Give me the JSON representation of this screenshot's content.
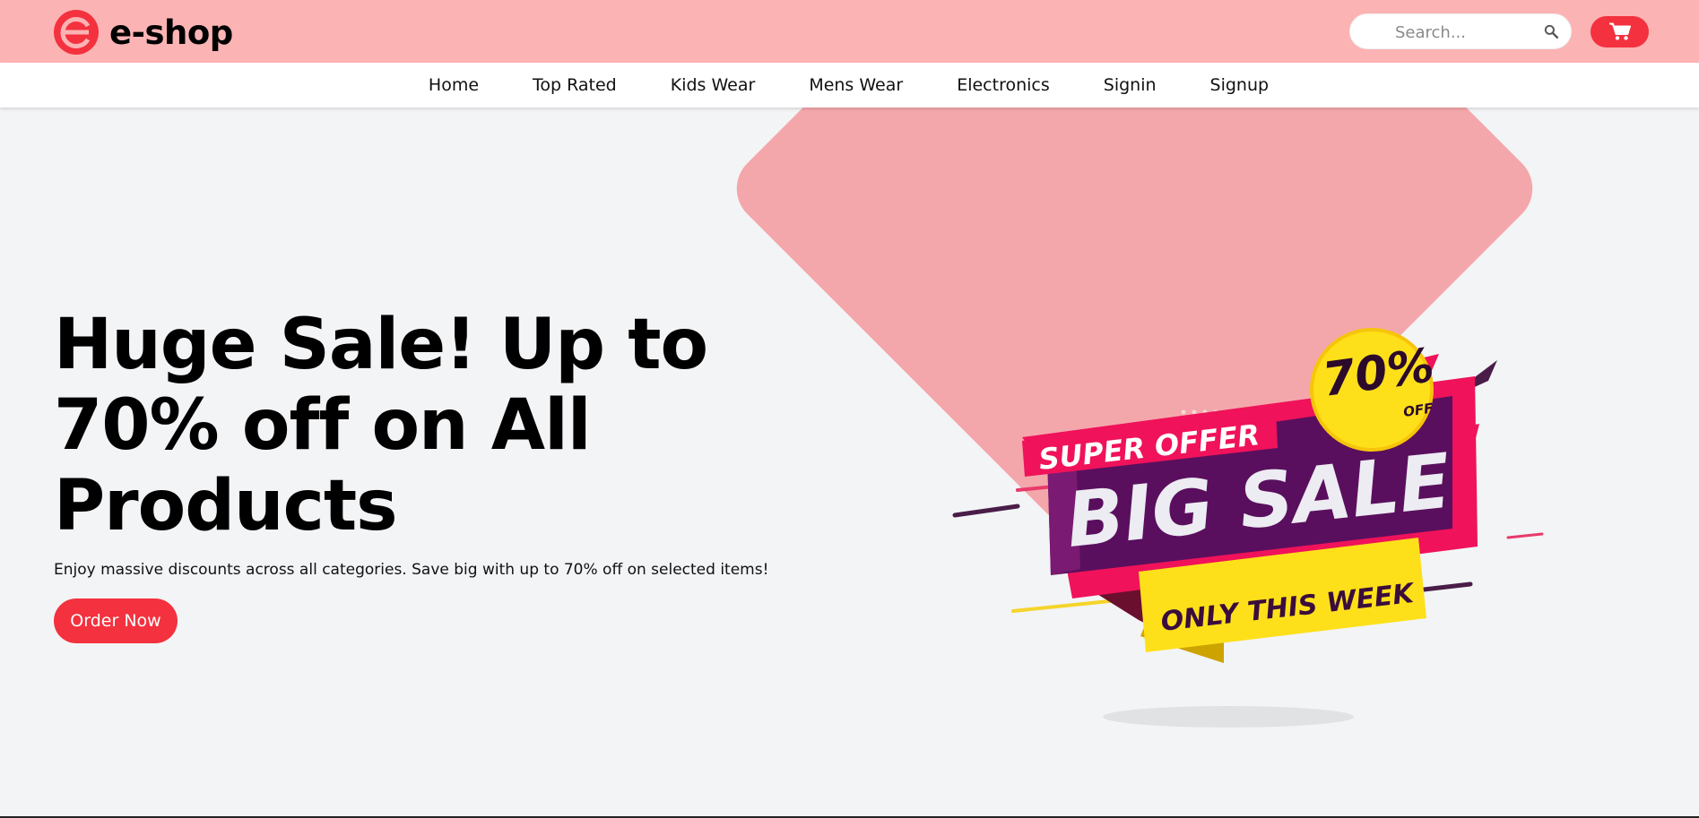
{
  "header": {
    "brand_name": "e-shop",
    "logo_icon": "e-logo-icon",
    "search_placeholder": "Search...",
    "search_icon": "search-icon",
    "cart_icon": "cart-icon"
  },
  "nav": {
    "items": [
      {
        "label": "Home"
      },
      {
        "label": "Top Rated"
      },
      {
        "label": "Kids Wear"
      },
      {
        "label": "Mens Wear"
      },
      {
        "label": "Electronics"
      },
      {
        "label": "Signin"
      },
      {
        "label": "Signup"
      }
    ]
  },
  "hero": {
    "title": "Huge Sale! Up to 70% off on All Products",
    "subtitle": "Enjoy massive discounts across all categories. Save big with up to 70% off on selected items!",
    "cta_label": "Order Now"
  },
  "banner": {
    "super_offer": "SUPER OFFER",
    "big_sale": "BIG SALE",
    "only_this_week": "ONLY THIS WEEK",
    "percent": "70%",
    "off": "OFF"
  },
  "colors": {
    "topbar": "#fcb3b4",
    "accent": "#f4313e",
    "diamond": "#f4a7ab",
    "background": "#f3f4f6"
  }
}
